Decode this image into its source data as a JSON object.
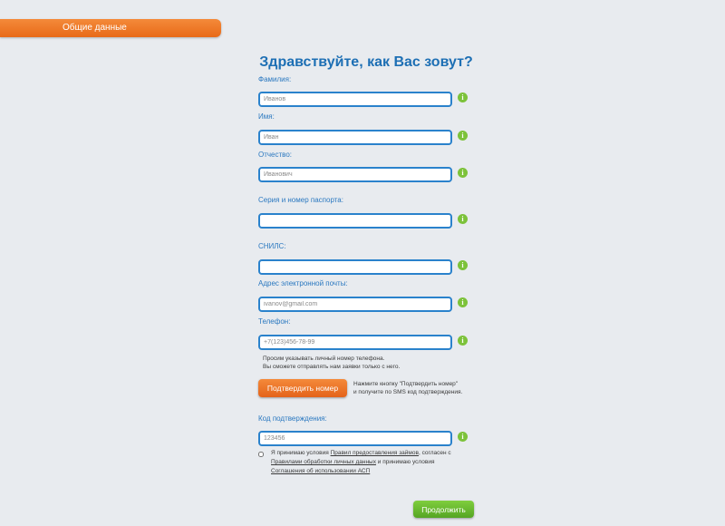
{
  "tab": {
    "label": "Общие данные"
  },
  "title": "Здравствуйте, как Вас зовут?",
  "fields": {
    "surname": {
      "label": "Фамилия:",
      "placeholder": "Иванов"
    },
    "name": {
      "label": "Имя:",
      "placeholder": "Иван"
    },
    "patronymic": {
      "label": "Отчество:",
      "placeholder": "Иванович"
    },
    "passport": {
      "label": "Серия и номер паспорта:",
      "placeholder": ""
    },
    "snils": {
      "label": "СНИЛС:",
      "placeholder": ""
    },
    "email": {
      "label": "Адрес электронной почты:",
      "placeholder": "ivanov@gmail.com"
    },
    "phone": {
      "label": "Телефон:",
      "placeholder": "+7(123)456-78-99"
    },
    "code": {
      "label": "Код подтверждения:",
      "placeholder": "123456"
    }
  },
  "info_icon": "i",
  "phone_note": {
    "line1": "Просим указывать личный номер телефона.",
    "line2": "Вы сможете отправлять нам заявки только с него."
  },
  "confirm_button": "Подтвердить номер",
  "confirm_hint": {
    "line1": "Нажмите кнопку \"Подтвердить номер\"",
    "line2": "и получите по SMS код подтверждения."
  },
  "consent": {
    "text1": "Я принимаю условия ",
    "link1": "Правил предоставления займов",
    "text2": ", согласен с",
    "link2": "Правилами обработки личных данных",
    "text3": " и принимаю условия",
    "link3": "Соглашения об использовании АСП"
  },
  "continue_button": "Продолжить"
}
